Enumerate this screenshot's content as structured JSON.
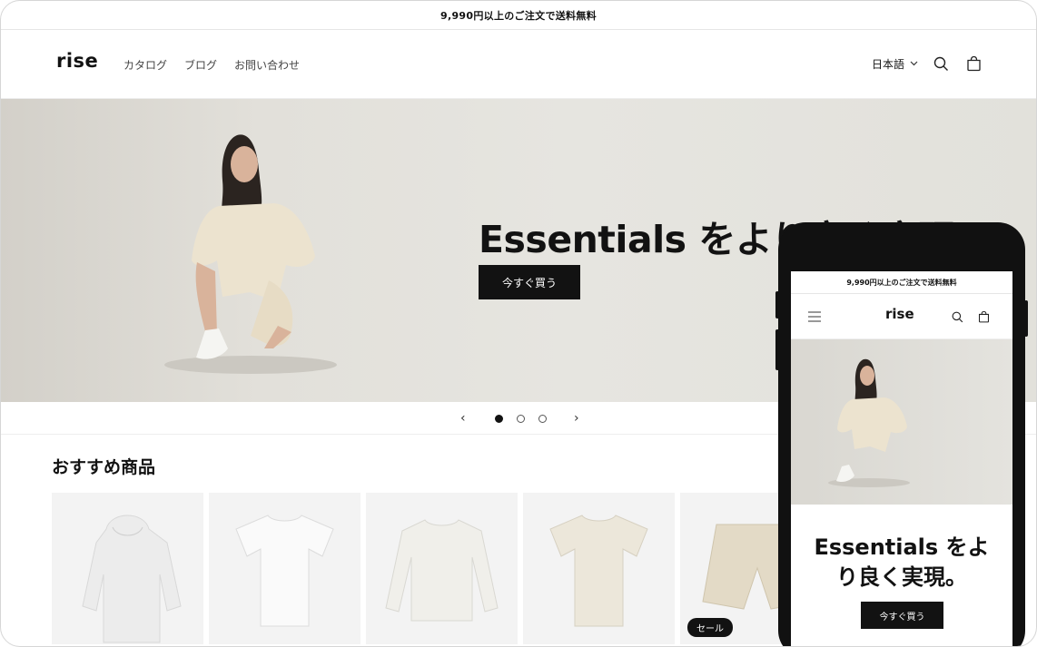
{
  "announcement": "9,990円以上のご注文で送料無料",
  "header": {
    "logo": "rise",
    "nav": [
      "カタログ",
      "ブログ",
      "お問い合わせ"
    ],
    "language": "日本語"
  },
  "hero": {
    "title": "Essentials をより良く実現",
    "button": "今すぐ買う"
  },
  "slider": {
    "slides": 3,
    "active": 1
  },
  "featured": {
    "title": "おすすめ商品",
    "products": [
      {
        "name": "hoodie"
      },
      {
        "name": "white-tshirt"
      },
      {
        "name": "sweatshirt"
      },
      {
        "name": "beige-tshirt"
      },
      {
        "name": "shorts",
        "badge": "セール"
      }
    ]
  },
  "mobile": {
    "announcement": "9,990円以上のご注文で送料無料",
    "logo": "rise",
    "title_line1": "Essentials をよ",
    "title_line2": "り良く実現。",
    "button": "今すぐ買う"
  }
}
